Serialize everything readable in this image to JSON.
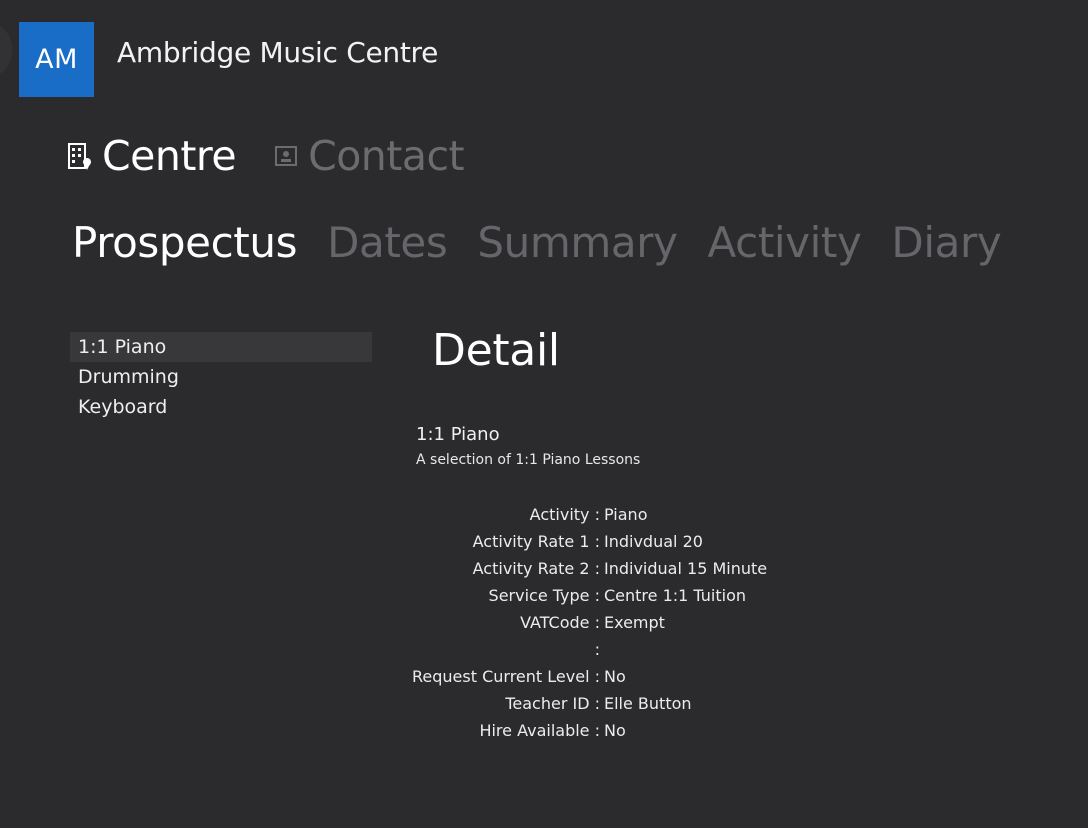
{
  "app": {
    "initials": "AM",
    "title": "Ambridge Music Centre"
  },
  "top_nav": [
    {
      "label": "Centre",
      "icon": "building-icon",
      "active": true
    },
    {
      "label": "Contact",
      "icon": "contact-card-icon",
      "active": false
    }
  ],
  "sub_tabs": [
    {
      "label": "Prospectus",
      "active": true
    },
    {
      "label": "Dates",
      "active": false
    },
    {
      "label": "Summary",
      "active": false
    },
    {
      "label": "Activity",
      "active": false
    },
    {
      "label": "Diary",
      "active": false
    }
  ],
  "list": {
    "items": [
      "1:1 Piano",
      "Drumming",
      "Keyboard"
    ],
    "selected": "1:1 Piano"
  },
  "detail": {
    "heading": "Detail",
    "name": "1:1 Piano",
    "description": "A selection of 1:1 Piano Lessons",
    "fields": [
      {
        "label": "Activity",
        "value": "Piano"
      },
      {
        "label": "Activity Rate 1",
        "value": "Indivdual 20"
      },
      {
        "label": "Activity Rate 2",
        "value": "Individual 15 Minute"
      },
      {
        "label": "Service Type",
        "value": "Centre 1:1 Tuition"
      },
      {
        "label": "VATCode",
        "value": "Exempt"
      },
      {
        "label": "",
        "value": ""
      },
      {
        "label": "Request Current Level",
        "value": "No"
      },
      {
        "label": "Teacher ID",
        "value": "Elle Button"
      },
      {
        "label": "Hire Available",
        "value": "No"
      }
    ],
    "separator": ":"
  },
  "colors": {
    "background": "#2b2b2d",
    "accent": "#1a6dc6",
    "inactive_text": "#66666a"
  }
}
